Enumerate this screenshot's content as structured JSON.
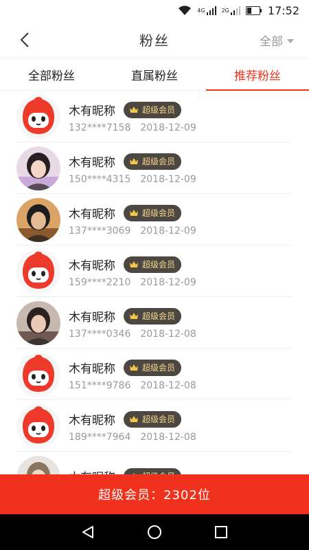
{
  "status_bar": {
    "network_1": "4G",
    "network_2": "2G",
    "network_3": "2G",
    "time": "17:52"
  },
  "header": {
    "title": "粉丝",
    "filter_label": "全部"
  },
  "tabs": [
    {
      "label": "全部粉丝",
      "active": false
    },
    {
      "label": "直属粉丝",
      "active": false
    },
    {
      "label": "推荐粉丝",
      "active": true
    }
  ],
  "fans": [
    {
      "nickname": "木有昵称",
      "badge": "超级会员",
      "phone": "132****7158",
      "date": "2018-12-09",
      "avatar": "default"
    },
    {
      "nickname": "木有昵称",
      "badge": "超级会员",
      "phone": "150****4315",
      "date": "2018-12-09",
      "avatar": "photo-1"
    },
    {
      "nickname": "木有昵称",
      "badge": "超级会员",
      "phone": "137****3069",
      "date": "2018-12-09",
      "avatar": "photo-2"
    },
    {
      "nickname": "木有昵称",
      "badge": "超级会员",
      "phone": "159****2210",
      "date": "2018-12-09",
      "avatar": "default"
    },
    {
      "nickname": "木有昵称",
      "badge": "超级会员",
      "phone": "137****0346",
      "date": "2018-12-08",
      "avatar": "photo-3"
    },
    {
      "nickname": "木有昵称",
      "badge": "超级会员",
      "phone": "151****9786",
      "date": "2018-12-08",
      "avatar": "default"
    },
    {
      "nickname": "木有昵称",
      "badge": "超级会员",
      "phone": "189****7964",
      "date": "2018-12-08",
      "avatar": "default"
    },
    {
      "nickname": "木有昵称",
      "badge": "超级会员",
      "phone": "",
      "date": "",
      "avatar": "photo-4"
    }
  ],
  "footer": {
    "summary": "超级会员：2302位"
  },
  "colors": {
    "accent": "#e8361f",
    "footer_bg": "#f0311d",
    "badge_bg": "#4c4741",
    "badge_text": "#f5d78e"
  },
  "icons": {
    "back": "chevron-left-icon",
    "filter_arrow": "triangle-down-icon",
    "crown": "crown-icon",
    "nav_back": "triangle-back-icon",
    "nav_home": "circle-home-icon",
    "nav_recent": "square-recent-icon"
  }
}
